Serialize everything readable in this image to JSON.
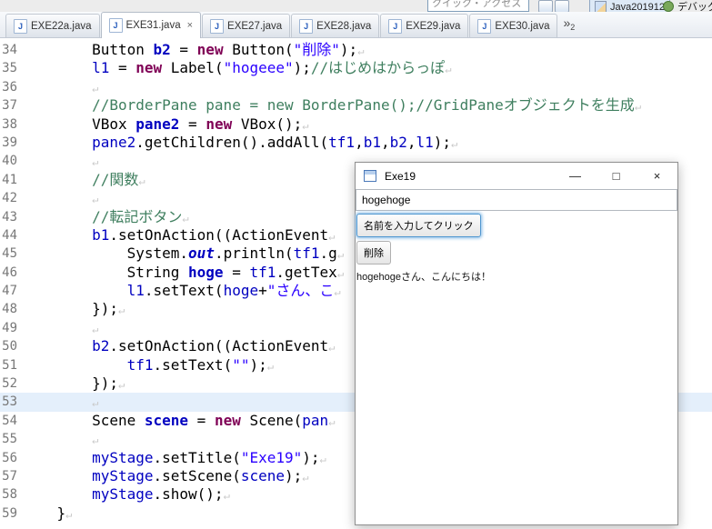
{
  "toolbar": {
    "quick_access_placeholder": "クイック・アクセス",
    "java_perspective": "Java201912",
    "debug_perspective": "デバッグ"
  },
  "tabs": [
    {
      "label": "EXE22a.java",
      "active": false
    },
    {
      "label": "EXE31.java",
      "active": true
    },
    {
      "label": "EXE27.java",
      "active": false
    },
    {
      "label": "EXE28.java",
      "active": false
    },
    {
      "label": "EXE29.java",
      "active": false
    },
    {
      "label": "EXE30.java",
      "active": false
    }
  ],
  "tab_icon_letter": "J",
  "tab_close_glyph": "×",
  "tab_overflow": {
    "chevrons": "»",
    "count": "2"
  },
  "editor": {
    "eol_marker": "↵",
    "lines": [
      {
        "n": 34,
        "s": [
          {
            "t": "        Button ",
            "c": "p"
          },
          {
            "t": "b2",
            "c": "fd"
          },
          {
            "t": " = ",
            "c": "p"
          },
          {
            "t": "new",
            "c": "k"
          },
          {
            "t": " Button(",
            "c": "p"
          },
          {
            "t": "\"削除\"",
            "c": "s"
          },
          {
            "t": ");",
            "c": "p"
          }
        ]
      },
      {
        "n": 35,
        "s": [
          {
            "t": "        ",
            "c": "p"
          },
          {
            "t": "l1",
            "c": "f"
          },
          {
            "t": " = ",
            "c": "p"
          },
          {
            "t": "new",
            "c": "k"
          },
          {
            "t": " Label(",
            "c": "p"
          },
          {
            "t": "\"hogeee\"",
            "c": "s"
          },
          {
            "t": ");",
            "c": "p"
          },
          {
            "t": "//はじめはからっぽ",
            "c": "c"
          }
        ]
      },
      {
        "n": 36,
        "s": [
          {
            "t": "        ",
            "c": "p"
          }
        ]
      },
      {
        "n": 37,
        "s": [
          {
            "t": "        ",
            "c": "p"
          },
          {
            "t": "//BorderPane pane = new BorderPane();//GridPaneオブジェクトを生成",
            "c": "c"
          }
        ]
      },
      {
        "n": 38,
        "s": [
          {
            "t": "        VBox ",
            "c": "p"
          },
          {
            "t": "pane2",
            "c": "fd"
          },
          {
            "t": " = ",
            "c": "p"
          },
          {
            "t": "new",
            "c": "k"
          },
          {
            "t": " VBox();",
            "c": "p"
          }
        ]
      },
      {
        "n": 39,
        "s": [
          {
            "t": "        ",
            "c": "p"
          },
          {
            "t": "pane2",
            "c": "f"
          },
          {
            "t": ".getChildren().addAll(",
            "c": "p"
          },
          {
            "t": "tf1",
            "c": "f"
          },
          {
            "t": ",",
            "c": "p"
          },
          {
            "t": "b1",
            "c": "f"
          },
          {
            "t": ",",
            "c": "p"
          },
          {
            "t": "b2",
            "c": "f"
          },
          {
            "t": ",",
            "c": "p"
          },
          {
            "t": "l1",
            "c": "f"
          },
          {
            "t": ");",
            "c": "p"
          }
        ]
      },
      {
        "n": 40,
        "s": [
          {
            "t": "        ",
            "c": "p"
          }
        ]
      },
      {
        "n": 41,
        "s": [
          {
            "t": "        ",
            "c": "p"
          },
          {
            "t": "//関数",
            "c": "c"
          }
        ]
      },
      {
        "n": 42,
        "s": [
          {
            "t": "        ",
            "c": "p"
          }
        ]
      },
      {
        "n": 43,
        "s": [
          {
            "t": "        ",
            "c": "p"
          },
          {
            "t": "//転記ボタン",
            "c": "c"
          }
        ]
      },
      {
        "n": 44,
        "s": [
          {
            "t": "        ",
            "c": "p"
          },
          {
            "t": "b1",
            "c": "f"
          },
          {
            "t": ".setOnAction((ActionEvent",
            "c": "p"
          }
        ]
      },
      {
        "n": 45,
        "s": [
          {
            "t": "            System.",
            "c": "p"
          },
          {
            "t": "out",
            "c": "sf"
          },
          {
            "t": ".println(",
            "c": "p"
          },
          {
            "t": "tf1",
            "c": "f"
          },
          {
            "t": ".g",
            "c": "p"
          }
        ]
      },
      {
        "n": 46,
        "s": [
          {
            "t": "            String ",
            "c": "p"
          },
          {
            "t": "hoge",
            "c": "fd"
          },
          {
            "t": " = ",
            "c": "p"
          },
          {
            "t": "tf1",
            "c": "f"
          },
          {
            "t": ".getTex",
            "c": "p"
          }
        ]
      },
      {
        "n": 47,
        "s": [
          {
            "t": "            ",
            "c": "p"
          },
          {
            "t": "l1",
            "c": "f"
          },
          {
            "t": ".setText(",
            "c": "p"
          },
          {
            "t": "hoge",
            "c": "f"
          },
          {
            "t": "+",
            "c": "p"
          },
          {
            "t": "\"さん、こ",
            "c": "s"
          }
        ]
      },
      {
        "n": 48,
        "s": [
          {
            "t": "        });",
            "c": "p"
          }
        ]
      },
      {
        "n": 49,
        "s": [
          {
            "t": "        ",
            "c": "p"
          }
        ]
      },
      {
        "n": 50,
        "s": [
          {
            "t": "        ",
            "c": "p"
          },
          {
            "t": "b2",
            "c": "f"
          },
          {
            "t": ".setOnAction((ActionEvent",
            "c": "p"
          }
        ]
      },
      {
        "n": 51,
        "s": [
          {
            "t": "            ",
            "c": "p"
          },
          {
            "t": "tf1",
            "c": "f"
          },
          {
            "t": ".setText(",
            "c": "p"
          },
          {
            "t": "\"\"",
            "c": "s"
          },
          {
            "t": ");",
            "c": "p"
          }
        ]
      },
      {
        "n": 52,
        "s": [
          {
            "t": "        });",
            "c": "p"
          }
        ]
      },
      {
        "n": 53,
        "hl": true,
        "s": [
          {
            "t": "        ",
            "c": "p"
          }
        ]
      },
      {
        "n": 54,
        "s": [
          {
            "t": "        Scene ",
            "c": "p"
          },
          {
            "t": "scene",
            "c": "fd"
          },
          {
            "t": " = ",
            "c": "p"
          },
          {
            "t": "new",
            "c": "k"
          },
          {
            "t": " Scene(",
            "c": "p"
          },
          {
            "t": "pan",
            "c": "f"
          }
        ]
      },
      {
        "n": 55,
        "s": [
          {
            "t": "        ",
            "c": "p"
          }
        ]
      },
      {
        "n": 56,
        "s": [
          {
            "t": "        ",
            "c": "p"
          },
          {
            "t": "myStage",
            "c": "f"
          },
          {
            "t": ".setTitle(",
            "c": "p"
          },
          {
            "t": "\"Exe19\"",
            "c": "s"
          },
          {
            "t": ");",
            "c": "p"
          }
        ]
      },
      {
        "n": 57,
        "s": [
          {
            "t": "        ",
            "c": "p"
          },
          {
            "t": "myStage",
            "c": "f"
          },
          {
            "t": ".setScene(",
            "c": "p"
          },
          {
            "t": "scene",
            "c": "f"
          },
          {
            "t": ");",
            "c": "p"
          }
        ]
      },
      {
        "n": 58,
        "s": [
          {
            "t": "        ",
            "c": "p"
          },
          {
            "t": "myStage",
            "c": "f"
          },
          {
            "t": ".show();",
            "c": "p"
          }
        ]
      },
      {
        "n": 59,
        "s": [
          {
            "t": "    }",
            "c": "p"
          }
        ]
      }
    ]
  },
  "app_window": {
    "title": "Exe19",
    "controls": {
      "minimize": "—",
      "maximize": "□",
      "close": "×"
    },
    "textfield_value": "hogehoge",
    "button_primary": "名前を入力してクリック",
    "button_delete": "削除",
    "greeting_label": "hogehogeさん、こんにちは！"
  },
  "colors": {
    "keyword": "#7f0055",
    "string": "#2a00ff",
    "comment": "#3f7f5f",
    "field": "#0000c0",
    "current_line_highlight": "#e4effb",
    "focus_ring": "#4e96d0"
  }
}
